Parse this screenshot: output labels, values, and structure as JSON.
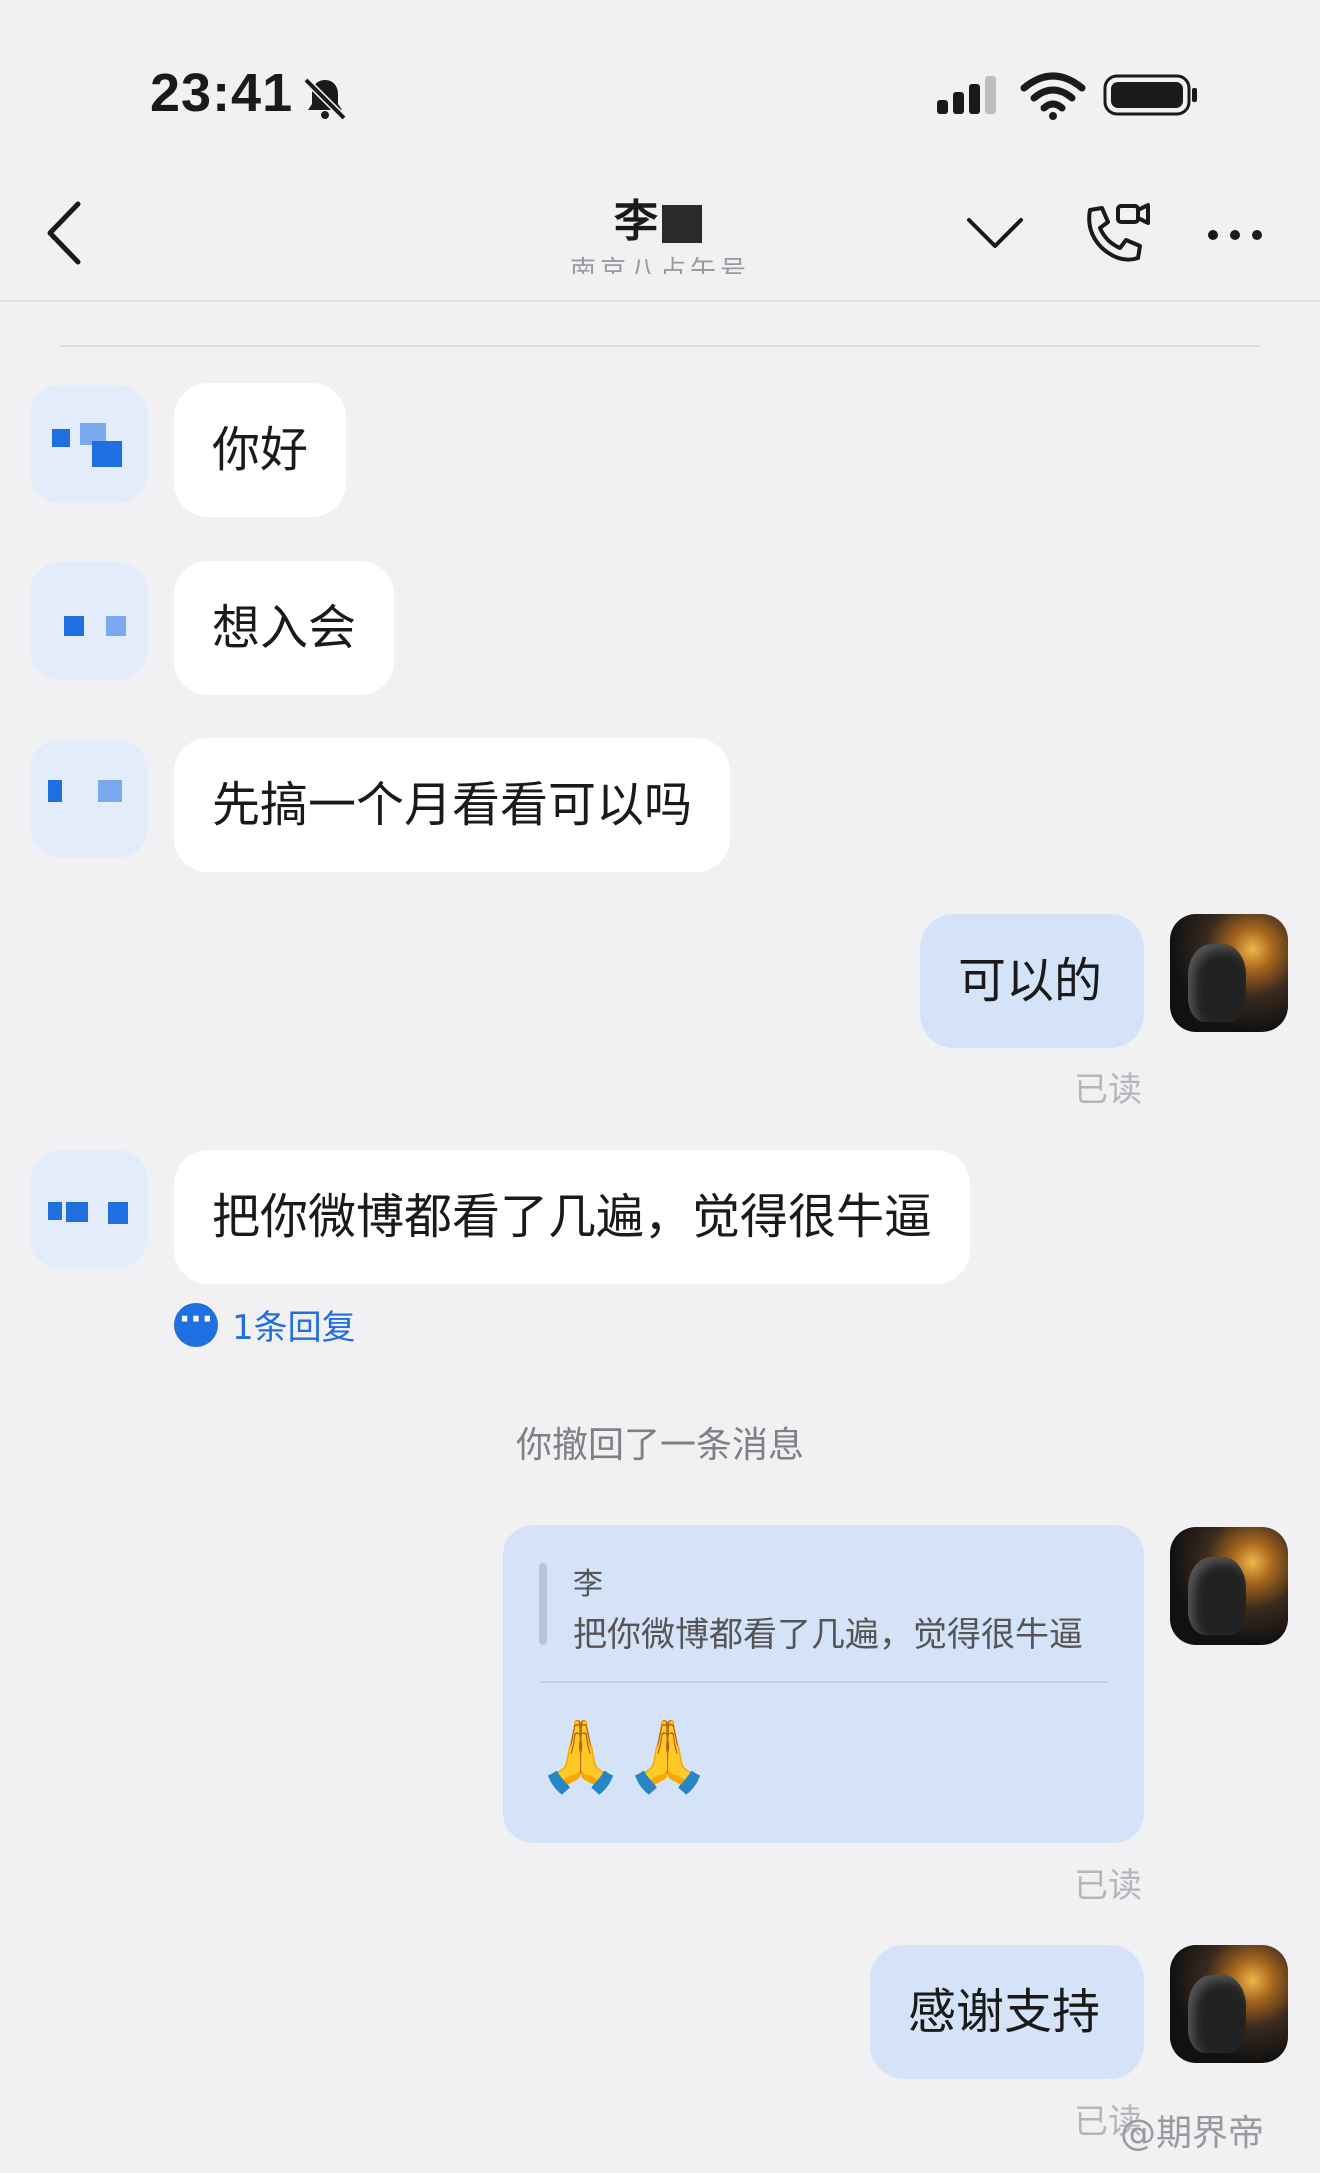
{
  "status_bar": {
    "time": "23:41"
  },
  "header": {
    "title_visible": "李",
    "subtitle": "南京八占午号"
  },
  "messages": [
    {
      "side": "left",
      "text": "你好"
    },
    {
      "side": "left",
      "text": "想入会"
    },
    {
      "side": "left",
      "text": "先搞一个月看看可以吗"
    },
    {
      "side": "right",
      "text": "可以的",
      "status": "已读"
    },
    {
      "side": "left",
      "text": "把你微博都看了几遍，觉得很牛逼",
      "reply_count_label": "1条回复"
    }
  ],
  "system_notice": "你撤回了一条消息",
  "quote_message": {
    "quoted_name": "李",
    "quoted_text": "把你微博都看了几遍，觉得很牛逼",
    "emoji": "🙏🙏",
    "status": "已读"
  },
  "last_message": {
    "text": "感谢支持",
    "status": "已读"
  },
  "watermark": "@期界帝",
  "colors": {
    "background": "#f1f1f4",
    "right_bubble": "#d5e3f8",
    "left_bubble": "#ffffff",
    "link": "#1f6fe0"
  },
  "icons": [
    "bell-slash-icon",
    "signal-icon",
    "wifi-icon",
    "battery-icon",
    "back-icon",
    "chevron-down-icon",
    "video-call-icon",
    "more-icon",
    "reply-bubble-icon"
  ]
}
